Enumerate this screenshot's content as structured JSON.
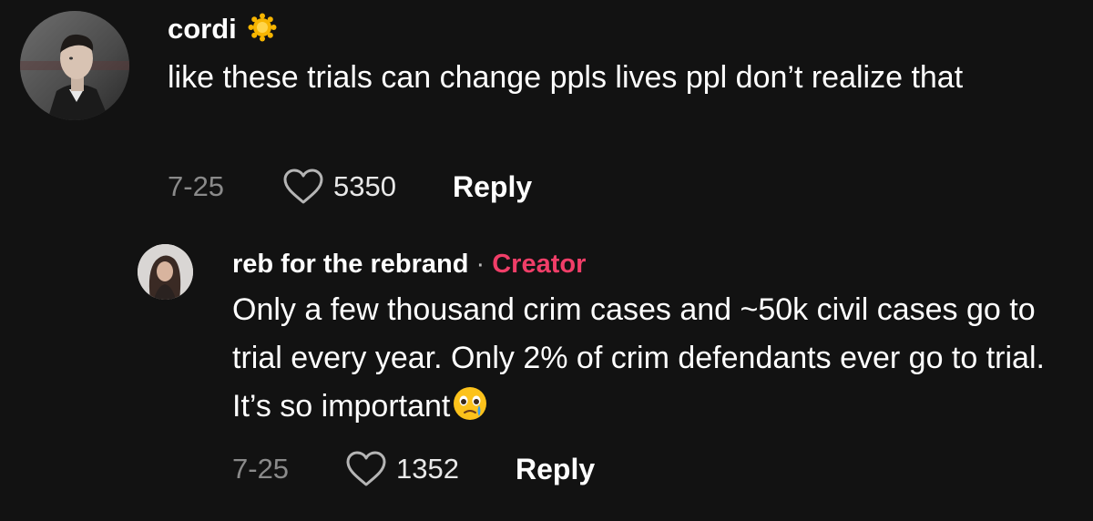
{
  "comment": {
    "username": "cordi",
    "text": "like these trials can change ppls lives ppl don’t realize that",
    "date": "7-25",
    "likes": "5350",
    "reply_label": "Reply",
    "badge_icon": "sun-badge-icon",
    "badge_color": "#f7b500"
  },
  "reply": {
    "username": "reb for the rebrand",
    "separator": " · ",
    "creator_label": "Creator",
    "creator_color": "#f03e68",
    "text": "Only a few thousand crim cases and ~50k civil cases go to trial every year. Only 2% of crim defendants ever go to trial. It’s so important",
    "emoji_icon": "crying-face-emoji",
    "date": "7-25",
    "likes": "1352",
    "reply_label": "Reply"
  }
}
